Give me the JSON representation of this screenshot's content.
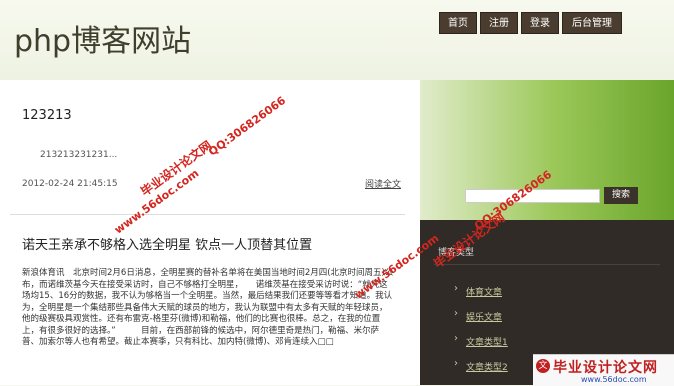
{
  "site": {
    "title": "php博客网站"
  },
  "nav": [
    {
      "label": "首页"
    },
    {
      "label": "注册"
    },
    {
      "label": "登录"
    },
    {
      "label": "后台管理"
    }
  ],
  "post": {
    "title": "123213",
    "excerpt": "213213231231...",
    "date": "2012-02-24 21:45:15",
    "read_more": "阅读全文"
  },
  "article": {
    "title": "诺天王亲承不够格入选全明星 钦点一人顶替其位置",
    "body": "新浪体育讯　北京时间2月6日消息，全明星赛的替补名单将在美国当地时间2月四(北京时间周五)公布，而诺维茨基今天在接受采访时，自己不够格打全明星，　　诺维茨基在接受采访时说：“就凭这场均15、16分的数据，我不认为够格当一个全明星。当然，最后结果我们还要等等看才知道。我认为，全明星是一个集结那些具备伟大天赋的球员的地方，我认为联盟中有太多有天赋的年轻球员，他的级赛极具观赏性。还有布雷克-格里芬(微博)和勒福，他们的比赛也很棒。总之，在我的位置上，有很多很好的选择。”　　　目前，在西部前锋的候选中，阿尔德里奇是热门，勒福、米尔萨普、加索尔等人也有希望。截止本赛季，只有科比、加内特(微博)、邓肯连续入□□"
  },
  "search": {
    "placeholder": "",
    "button": "搜索"
  },
  "sidebar": {
    "heading": "博客类型",
    "categories": [
      {
        "label": "体育文章"
      },
      {
        "label": "娱乐文章"
      },
      {
        "label": "文章类型1"
      },
      {
        "label": "文章类型2"
      }
    ]
  },
  "watermarks": {
    "site_cn": "毕业设计论文网",
    "url": "www.56doc.com",
    "qq": "QQ:306826066",
    "bottom_title": "毕业设计论文网",
    "bottom_url": "www.56doc.com"
  },
  "colors": {
    "nav_bg": "#4a3d30",
    "accent_green": "#6fa82a",
    "sidebar_bg": "#302b26",
    "watermark_red": "#d4261f"
  }
}
